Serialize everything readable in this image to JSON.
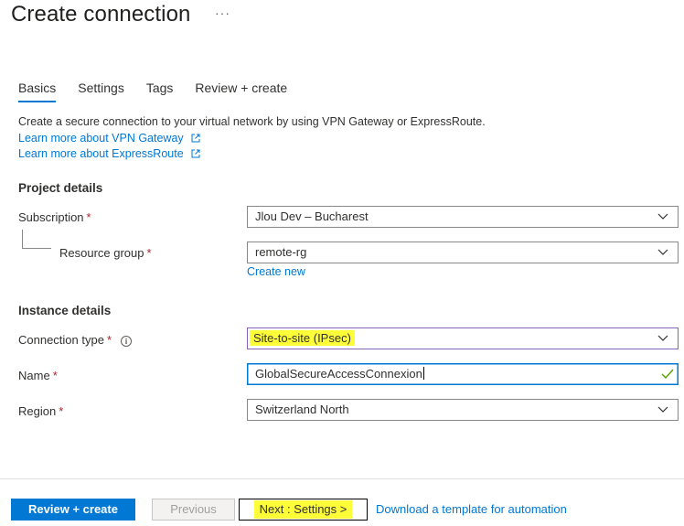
{
  "header": {
    "title": "Create connection",
    "more": "···"
  },
  "tabs": [
    {
      "label": "Basics",
      "active": true
    },
    {
      "label": "Settings",
      "active": false
    },
    {
      "label": "Tags",
      "active": false
    },
    {
      "label": "Review + create",
      "active": false
    }
  ],
  "intro": {
    "text": "Create a secure connection to your virtual network by using VPN Gateway or ExpressRoute.",
    "link_vpn": "Learn more about VPN Gateway",
    "link_er": "Learn more about ExpressRoute"
  },
  "project": {
    "heading": "Project details",
    "subscription_label": "Subscription",
    "subscription_value": "Jlou Dev – Bucharest",
    "rg_label": "Resource group",
    "rg_value": "remote-rg",
    "create_new": "Create new"
  },
  "instance": {
    "heading": "Instance details",
    "conn_type_label": "Connection type",
    "conn_type_value": "Site-to-site (IPsec)",
    "name_label": "Name",
    "name_value": "GlobalSecureAccessConnexion",
    "region_label": "Region",
    "region_value": "Switzerland North"
  },
  "required_marker": "*",
  "footer": {
    "review_create": "Review + create",
    "previous": "Previous",
    "next": "Next : Settings >",
    "download": "Download a template for automation"
  },
  "colors": {
    "accent": "#0078d4",
    "required": "#a4262c",
    "highlight": "#fdfd38",
    "valid": "#57a300"
  }
}
